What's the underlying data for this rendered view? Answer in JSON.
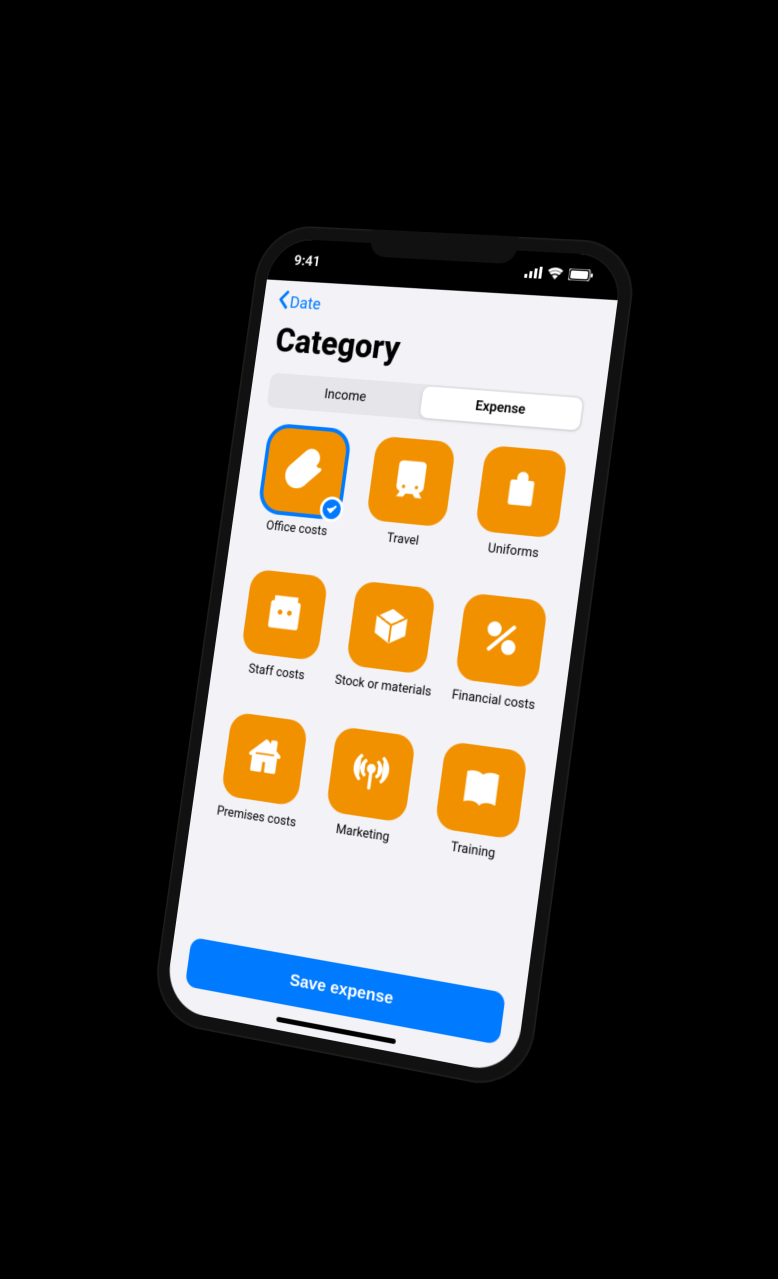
{
  "status": {
    "time": "9:41"
  },
  "nav": {
    "back_label": "Date"
  },
  "title": "Category",
  "segments": {
    "income": "Income",
    "expense": "Expense",
    "active": "expense"
  },
  "categories": [
    {
      "id": "office_costs",
      "label": "Office costs",
      "icon": "paperclip",
      "selected": true
    },
    {
      "id": "travel",
      "label": "Travel",
      "icon": "train",
      "selected": false
    },
    {
      "id": "uniforms",
      "label": "Uniforms",
      "icon": "bag",
      "selected": false
    },
    {
      "id": "staff_costs",
      "label": "Staff costs",
      "icon": "people",
      "selected": false
    },
    {
      "id": "stock",
      "label": "Stock or materials",
      "icon": "box",
      "selected": false
    },
    {
      "id": "financial",
      "label": "Financial costs",
      "icon": "percent",
      "selected": false
    },
    {
      "id": "premises",
      "label": "Premises costs",
      "icon": "house",
      "selected": false
    },
    {
      "id": "marketing",
      "label": "Marketing",
      "icon": "broadcast",
      "selected": false
    },
    {
      "id": "training",
      "label": "Training",
      "icon": "book",
      "selected": false
    }
  ],
  "save_button": "Save expense",
  "colors": {
    "accent": "#007aff",
    "tile": "#f29100"
  }
}
